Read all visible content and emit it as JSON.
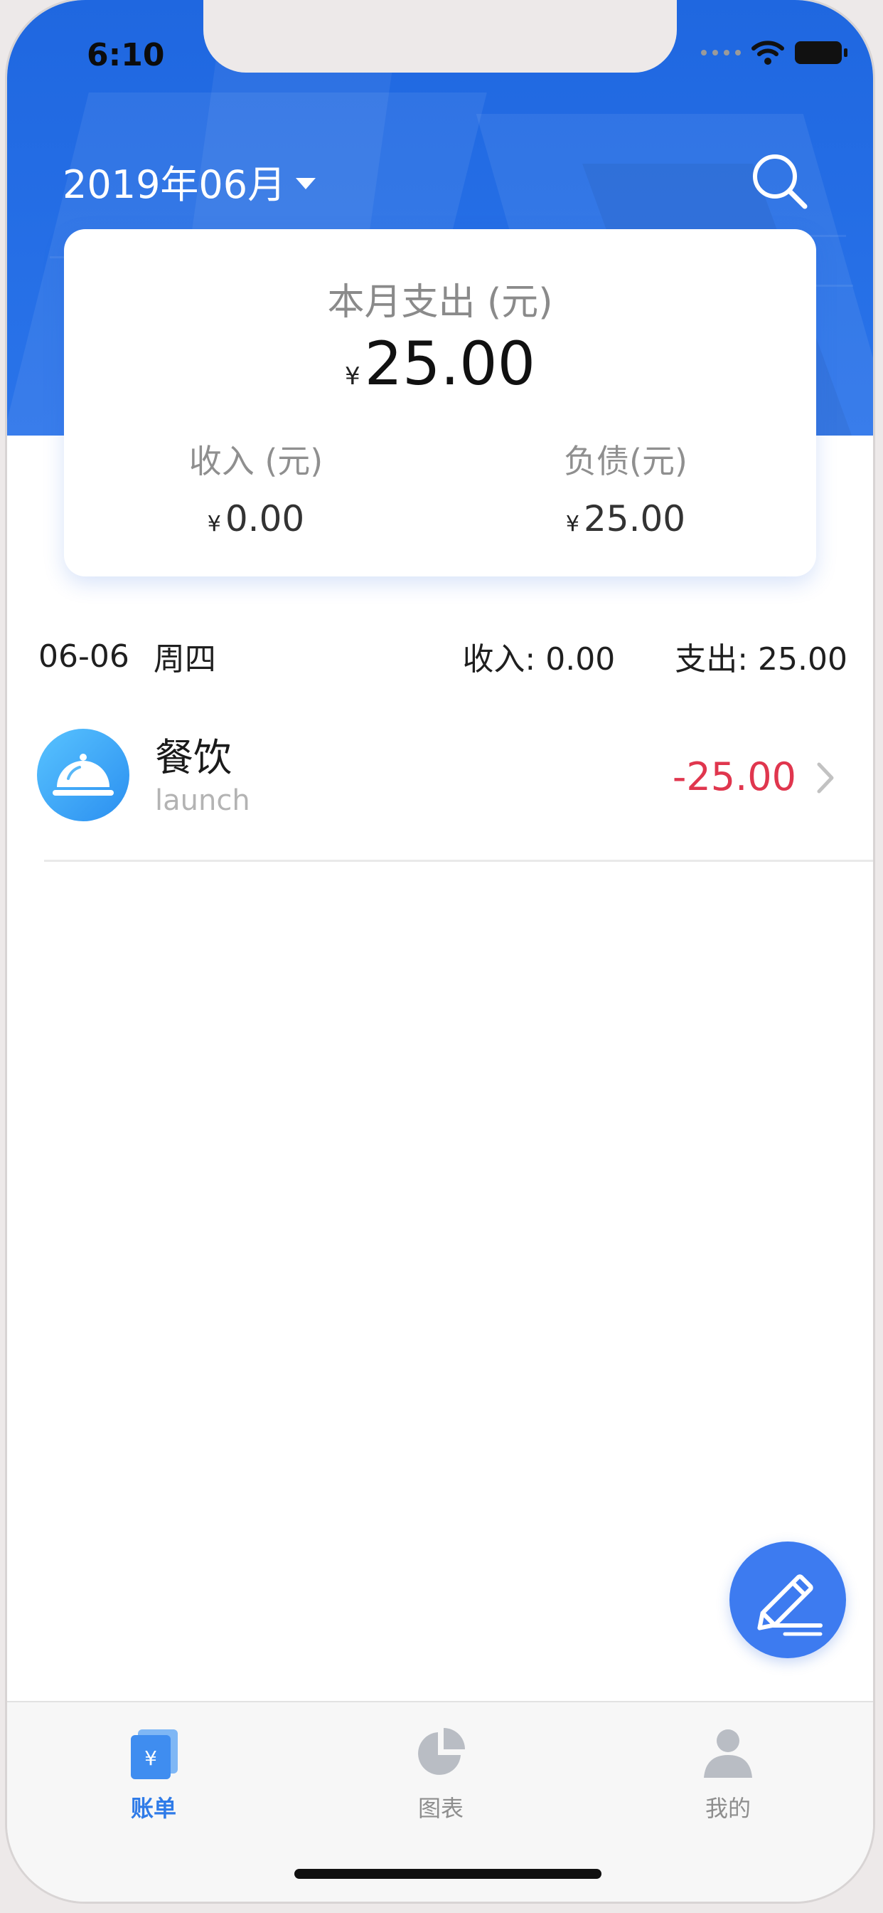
{
  "status_bar": {
    "time": "6:10"
  },
  "header": {
    "month": "2019年06月"
  },
  "summary": {
    "title": "本月支出 (元)",
    "currency": "¥",
    "total": "25.00",
    "income_label": "收入 (元)",
    "income_value": "0.00",
    "debt_label": "负债(元)",
    "debt_value": "25.00"
  },
  "day": {
    "date": "06-06",
    "weekday": "周四",
    "income_text": "收入:  0.00",
    "expense_text": "支出:  25.00"
  },
  "records": [
    {
      "category": "餐饮",
      "note": "launch",
      "amount": "-25.00",
      "icon": "food-cloche-icon"
    }
  ],
  "tabs": [
    {
      "label": "账单",
      "icon": "bill-icon",
      "active": true
    },
    {
      "label": "图表",
      "icon": "pie-chart-icon",
      "active": false
    },
    {
      "label": "我的",
      "icon": "profile-icon",
      "active": false
    }
  ],
  "colors": {
    "header_blue": "#2a74ea",
    "accent": "#2f7be8",
    "expense_red": "#e0364e",
    "fab_blue": "#3d7bf0"
  }
}
